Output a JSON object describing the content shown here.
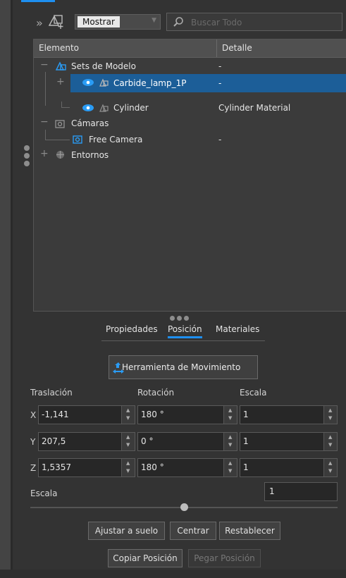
{
  "toolbar": {
    "show_label": "Mostrar",
    "search_placeholder": "Buscar Todo"
  },
  "tree": {
    "col_element": "Elemento",
    "col_detail": "Detalle",
    "rows": [
      {
        "label": "Sets de Modelo",
        "detail": "-",
        "icon": "model-set-icon"
      },
      {
        "label": "Carbide_lamp_1P",
        "detail": "-",
        "icon": "model-icon",
        "selected": true
      },
      {
        "label": "Cylinder",
        "detail": "Cylinder Material",
        "icon": "model-icon"
      },
      {
        "label": "Cámaras",
        "detail": "",
        "icon": "camera-group-icon"
      },
      {
        "label": "Free Camera",
        "detail": "-",
        "icon": "camera-icon"
      },
      {
        "label": "Entornos",
        "detail": "",
        "icon": "environment-icon"
      }
    ]
  },
  "tabs": [
    "Propiedades",
    "Posición",
    "Materiales"
  ],
  "active_tab": "Posición",
  "move_tool_label": "Herramienta de Movimiento",
  "transform": {
    "translation_label": "Traslación",
    "rotation_label": "Rotación",
    "scale_label": "Escala",
    "rows": [
      {
        "axis": "X",
        "translation": "-1,141",
        "rotation": "180 °",
        "scale": "1"
      },
      {
        "axis": "Y",
        "translation": "207,5",
        "rotation": "0 °",
        "scale": "1"
      },
      {
        "axis": "Z",
        "translation": "1,5357",
        "rotation": "180 °",
        "scale": "1"
      }
    ]
  },
  "uniform_scale": {
    "label": "Escala",
    "value": "1"
  },
  "buttons": {
    "snap_to_ground": "Ajustar a suelo",
    "center": "Centrar",
    "reset": "Restablecer",
    "copy_position": "Copiar Posición",
    "paste_position": "Pegar Posición"
  },
  "colors": {
    "accent": "#1e8ff0",
    "selection": "#1c5e98",
    "eye": "#2a9cf5"
  }
}
